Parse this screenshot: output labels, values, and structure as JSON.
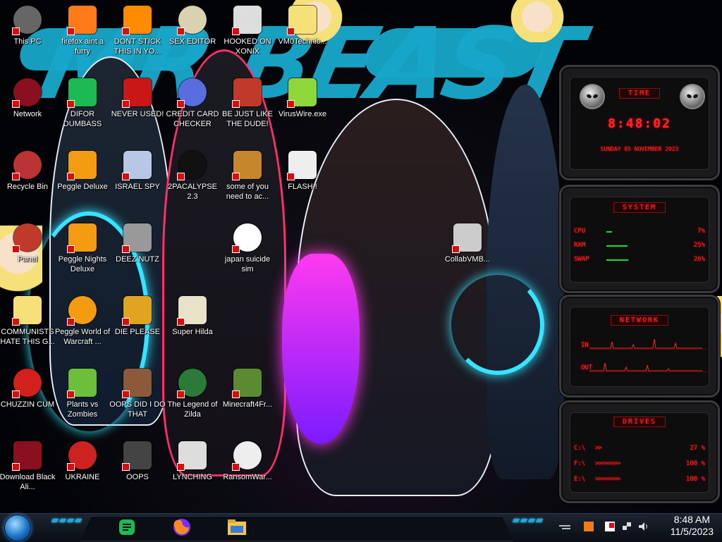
{
  "desktop_icons": [
    {
      "label": "This PC",
      "icon": "computer-icon"
    },
    {
      "label": "firefox aint a furry",
      "icon": "firefox-icon"
    },
    {
      "label": "DONT STICK THIS IN YO...",
      "icon": "vlc-cone-icon"
    },
    {
      "label": "SEX EDITOR",
      "icon": "hxd-editor-icon"
    },
    {
      "label": "HOOKED ON XONIX",
      "icon": "xonix-game-icon"
    },
    {
      "label": "VM0Technic...",
      "icon": "star-character-icon"
    },
    {
      "label": "Network",
      "icon": "network-globe-icon"
    },
    {
      "label": "DIFOR DUMBASS",
      "icon": "discord-like-icon"
    },
    {
      "label": "NEVER USED!",
      "icon": "dev-cpp-icon"
    },
    {
      "label": "CREDIT CARD CHECKER",
      "icon": "credit-card-icon"
    },
    {
      "label": "BE JUST LIKE THE DUDE!",
      "icon": "santa-icon"
    },
    {
      "label": "VirusWire.exe",
      "icon": "lime-icon"
    },
    {
      "label": "Recycle Bin",
      "icon": "recycle-bin-icon"
    },
    {
      "label": "Peggle Deluxe",
      "icon": "peggle-icon"
    },
    {
      "label": "ISRAEL SPY",
      "icon": "network-spy-icon"
    },
    {
      "label": "2PACALYPSE 2.3",
      "icon": "terminal-icon"
    },
    {
      "label": "some of you need to ac...",
      "icon": "dog-icon"
    },
    {
      "label": "FLASH !",
      "icon": "flash-file-icon"
    },
    {
      "label": "Panel",
      "icon": "control-panel-icon"
    },
    {
      "label": "Peggle Nights Deluxe",
      "icon": "peggle-nights-icon"
    },
    {
      "label": "DEEZ NUTZ",
      "icon": "windows-stack-icon"
    },
    {
      "label": "japan suicide sim",
      "icon": "document-icon"
    },
    {
      "label": "CollabVMB...",
      "icon": "collabvm-icon"
    },
    {
      "label": "COMMUNISTS HATE THIS G...",
      "icon": "star-butterfly-icon"
    },
    {
      "label": "Peggle World of Warcraft ...",
      "icon": "peggle-wow-icon"
    },
    {
      "label": "DIE PLEASE",
      "icon": "de-icon"
    },
    {
      "label": "Super Hilda",
      "icon": "pixel-art-icon"
    },
    {
      "label": "CHUZZIN CUM",
      "icon": "chuzzle-icon"
    },
    {
      "label": "Plants vs Zombies",
      "icon": "pvz-icon"
    },
    {
      "label": "OOPS DID I DO THAT",
      "icon": "portrait-icon"
    },
    {
      "label": "The Legend of Zilda",
      "icon": "zelda-icon"
    },
    {
      "label": "Minecraft4Fr...",
      "icon": "minecraft-icon"
    },
    {
      "label": "Download Black Ali...",
      "icon": "alienware-icon"
    },
    {
      "label": "UKRAINE",
      "icon": "radiation-icon"
    },
    {
      "label": "OOPS",
      "icon": "oops-icon"
    },
    {
      "label": "LYNCHING",
      "icon": "flag-shield-icon"
    },
    {
      "label": "RansomWar...",
      "icon": "skull-icon"
    }
  ],
  "gadgets": {
    "time": {
      "title": "TIME",
      "clock": "8:48:02",
      "date": "SUNDAY 05 NOVEMBER 2023"
    },
    "system": {
      "title": "SYSTEM",
      "rows": [
        {
          "label": "CPU",
          "value": "7%",
          "level": 0.07
        },
        {
          "label": "RAM",
          "value": "25%",
          "level": 0.25
        },
        {
          "label": "SWAP",
          "value": "26%",
          "level": 0.26
        }
      ]
    },
    "network": {
      "title": "NETWORK",
      "in_label": "IN",
      "out_label": "OUT"
    },
    "drives": {
      "title": "DRIVES",
      "rows": [
        {
          "label": "C:\\",
          "value": "27 %",
          "level": 0.27
        },
        {
          "label": "F:\\",
          "value": "100 %",
          "level": 1.0
        },
        {
          "label": "E:\\",
          "value": "100 %",
          "level": 1.0
        }
      ]
    }
  },
  "taskbar": {
    "apps": [
      "messenger-app-icon",
      "firefox-icon",
      "file-explorer-icon"
    ],
    "tray": [
      "network-icon",
      "volume-icon",
      "flag-icon",
      "update-icon"
    ],
    "time": "8:48 AM",
    "date": "11/5/2023"
  },
  "colors": {
    "accent_red": "#ff2626",
    "wallpaper_cyan": "#17a7c9",
    "taskbar_blue": "#1fa8d8"
  }
}
